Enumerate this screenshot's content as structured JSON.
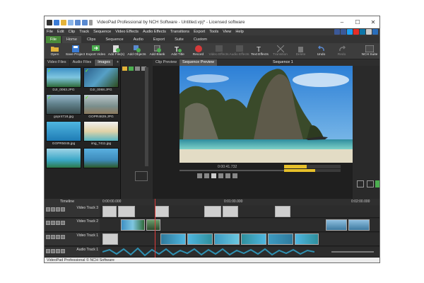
{
  "window": {
    "title": "VideoPad Professional by NCH Software - Untitled.vpj* - Licensed software"
  },
  "menu": [
    "File",
    "Edit",
    "Clip",
    "Track",
    "Sequence",
    "Video Effects",
    "Audio Effects",
    "Transitions",
    "Export",
    "Tools",
    "View",
    "Help"
  ],
  "ribbon_tabs": [
    "File",
    "Home",
    "Clips",
    "Sequence",
    "Audio",
    "Export",
    "Suite",
    "Custom"
  ],
  "toolbar": [
    {
      "label": "Open",
      "icon": "folder-icon",
      "dim": false
    },
    {
      "label": "Save Project",
      "icon": "save-icon",
      "dim": false
    },
    {
      "label": "Export Video",
      "icon": "export-icon",
      "dim": false
    },
    {
      "label": "Add File(s)",
      "icon": "add-file-icon",
      "dim": false
    },
    {
      "label": "Add Objects",
      "icon": "add-objects-icon",
      "dim": false
    },
    {
      "label": "Add Blank",
      "icon": "add-blank-icon",
      "dim": false
    },
    {
      "label": "Add Title",
      "icon": "title-icon",
      "dim": false
    },
    {
      "label": "Record",
      "icon": "record-icon",
      "dim": false
    },
    {
      "label": "Video Effects",
      "icon": "video-effects-icon",
      "dim": true
    },
    {
      "label": "Audio Effects",
      "icon": "audio-effects-icon",
      "dim": true
    },
    {
      "label": "Text Effects",
      "icon": "text-effects-icon",
      "dim": false
    },
    {
      "label": "Transition",
      "icon": "transition-icon",
      "dim": true
    },
    {
      "label": "Delete",
      "icon": "delete-icon",
      "dim": true
    },
    {
      "label": "Undo",
      "icon": "undo-icon",
      "dim": false
    },
    {
      "label": "Redo",
      "icon": "redo-icon",
      "dim": true
    },
    {
      "label": "NCH Suite",
      "icon": "nch-suite-icon",
      "dim": false
    }
  ],
  "media_tabs": [
    "Video Files",
    "Audio Files",
    "Images"
  ],
  "media_files": [
    {
      "name": "DJI_0063.JPG"
    },
    {
      "name": "DJI_0068.JPG"
    },
    {
      "name": "gopr4718.jpg"
    },
    {
      "name": "GOPR4829.JPG"
    },
    {
      "name": "GOPR5045.jpg"
    },
    {
      "name": "img_7411.jpg"
    },
    {
      "name": "",
      "partial": true
    },
    {
      "name": "",
      "partial": true
    }
  ],
  "preview": {
    "tabs": [
      "Clip Preview",
      "Sequence Preview"
    ],
    "sequence_label": "Sequence 1",
    "time": "0:00:41.732"
  },
  "timeline": {
    "label": "Timeline",
    "ruler": [
      "0:00:00.000",
      "0:01:00.000",
      "0:02:00.000"
    ],
    "tracks": [
      "Video Track 3",
      "Video Track 2",
      "Video Track 1",
      "Audio Track 1"
    ]
  },
  "statusbar": "VideoPad Professional © NCH Software",
  "colors": {
    "accent": "#4a8a3a",
    "playhead": "#e03a3a",
    "audio_wave": "#2f8fb0"
  }
}
